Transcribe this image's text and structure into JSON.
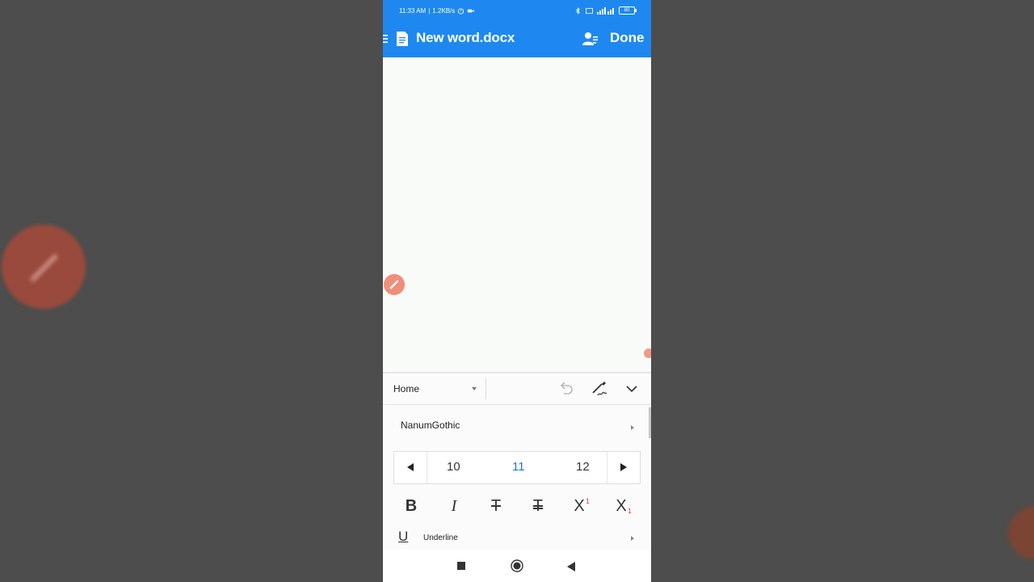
{
  "status_bar": {
    "time": "11:33 AM",
    "speed": "1.2KB/s",
    "battery": "80",
    "icons": [
      "alarm-icon",
      "video-icon",
      "bluetooth-icon",
      "volte-icon",
      "signal-icon",
      "battery-icon"
    ]
  },
  "app_bar": {
    "menu_icon": "menu-icon",
    "doc_icon": "document-icon",
    "title": "New word.docx",
    "share_icon": "share-user-icon",
    "done_label": "Done",
    "color": "#1e88f0"
  },
  "document": {
    "fab_icon": "pen-icon",
    "fab_color": "#ef8f7b"
  },
  "ribbon": {
    "tab_selected": "Home",
    "undo_icon": "undo-icon",
    "pen_mode_icon": "pen-mode-icon",
    "collapse_icon": "chevron-down-icon"
  },
  "font": {
    "name": "NanumGothic"
  },
  "font_size": {
    "options": [
      "10",
      "11",
      "12"
    ],
    "selected": "11",
    "accent": "#1e78d2"
  },
  "text_styles": {
    "bold": "B",
    "italic": "I",
    "strikethrough": "T",
    "double_strikethrough": "T",
    "superscript": "X",
    "superscript_mark": "1",
    "subscript": "X",
    "subscript_mark": "1"
  },
  "underline": {
    "icon_glyph": "U",
    "label": "Underline"
  },
  "nav_bar": {
    "icons": [
      "recents-icon",
      "home-icon",
      "back-icon"
    ]
  }
}
